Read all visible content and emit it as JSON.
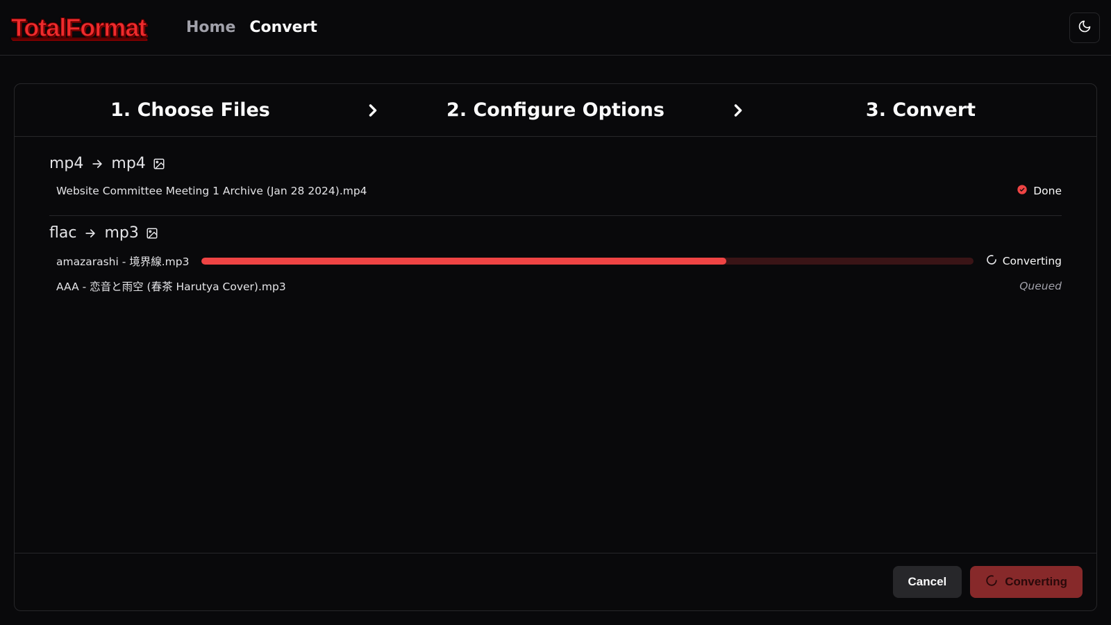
{
  "brand": "TotalFormat",
  "nav": {
    "home": "Home",
    "convert": "Convert"
  },
  "steps": {
    "s1": "1. Choose Files",
    "s2": "2. Configure Options",
    "s3": "3. Convert"
  },
  "groups": [
    {
      "from": "mp4",
      "to": "mp4",
      "rows": [
        {
          "name": "Website Committee Meeting 1 Archive (Jan 28 2024).mp4",
          "state": "done",
          "label": "Done"
        }
      ]
    },
    {
      "from": "flac",
      "to": "mp3",
      "rows": [
        {
          "name": "amazarashi - 境界線.mp3",
          "state": "converting",
          "label": "Converting",
          "progress_pct": 68
        },
        {
          "name": "AAA - 恋音と雨空 (春茶 Harutya Cover).mp3",
          "state": "queued",
          "label": "Queued"
        }
      ]
    }
  ],
  "footer": {
    "cancel": "Cancel",
    "primary": "Converting"
  },
  "colors": {
    "accent": "#ef4444",
    "border": "#27272a",
    "bg": "#09090b"
  }
}
